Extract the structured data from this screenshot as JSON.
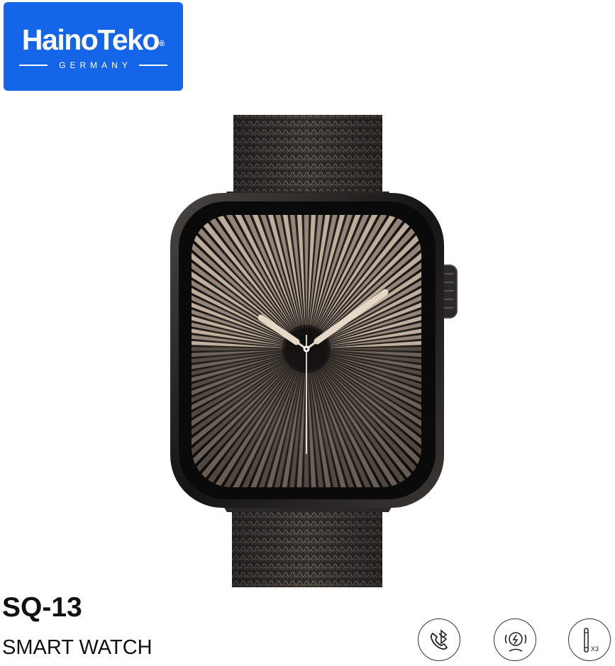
{
  "brand": {
    "name": "HainoTeko",
    "registered": "®",
    "subtitle": "GERMANY",
    "background_color": "#1565e8"
  },
  "product": {
    "model": "SQ-13",
    "category": "SMART WATCH"
  },
  "feature_icons": [
    {
      "name": "bluetooth-call-icon",
      "text": ""
    },
    {
      "name": "wireless-charging-icon",
      "text": ""
    },
    {
      "name": "strap-pins-icon",
      "text": "X3"
    }
  ],
  "colors": {
    "strap": "#3b3836",
    "case": "#1c1b1a",
    "dial_highlight": "#e6d8c6"
  }
}
